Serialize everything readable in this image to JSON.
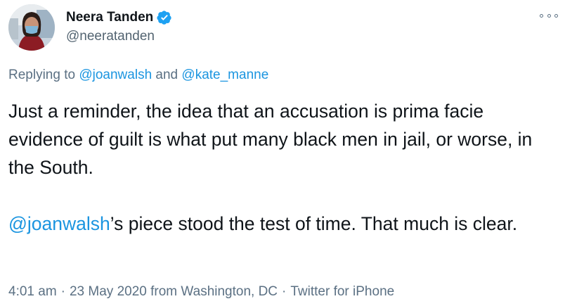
{
  "author": {
    "display_name": "Neera Tanden",
    "handle": "@neeratanden",
    "verified": true,
    "verified_icon": "verified-badge-icon",
    "avatar_icon": "profile-photo"
  },
  "menu_icon": "more-options-icon",
  "replying": {
    "prefix": "Replying to ",
    "mention1": "@joanwalsh",
    "conjunction": " and ",
    "mention2": "@kate_manne"
  },
  "body": {
    "paragraph1": "Just a reminder, the idea that an accusation is prima facie evidence of guilt is what put many black men in jail, or worse, in the South.",
    "paragraph2_mention": "@joanwalsh",
    "paragraph2_rest": "’s piece stood the test of time. That much is clear."
  },
  "meta": {
    "time": "4:01 am",
    "separator": "·",
    "date_location": "23 May 2020 from Washington, DC",
    "client": "Twitter for iPhone"
  },
  "colors": {
    "link": "#1b95e0",
    "secondary_text": "#5b7083",
    "verified": "#1da1f2"
  }
}
